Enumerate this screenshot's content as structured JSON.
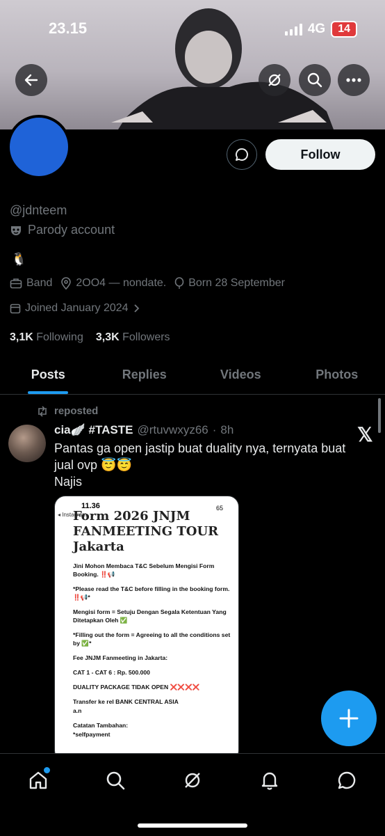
{
  "status_bar": {
    "time": "23.15",
    "network": "4G",
    "battery": "14"
  },
  "profile": {
    "handle": "@jdnteem",
    "parody_label": "Parody account",
    "bio_emoji": "🐧",
    "category": "Band",
    "location": "2OO4 — nondate.",
    "birthday": "Born 28 September",
    "joined": "Joined January 2024",
    "following_count": "3,1K",
    "following_label": "Following",
    "followers_count": "3,3K",
    "followers_label": "Followers",
    "follow_label": "Follow"
  },
  "tabs": [
    "Posts",
    "Replies",
    "Videos",
    "Photos"
  ],
  "post": {
    "reposted_label": "reposted",
    "author_name": "cia🪽 #TASTE",
    "author_handle": "@rtuvwxyz66",
    "time": "8h",
    "text_line1": "Pantas ga open jastip buat duality nya, ternyata buat jual ovp 😇😇",
    "text_line2": "Najis",
    "media": {
      "time": "11.36",
      "app": "◂ Instagram",
      "battery": "65",
      "title": "Form 2026 JNJM FANMEETING TOUR Jakarta",
      "line1": "Jini Mohon Membaca T&C Sebelum Mengisi Form Booking. ‼️📢",
      "line2": "*Please read the T&C before filling in the booking form. ‼️📢*",
      "line3": "Mengisi form = Setuju Dengan Segala Ketentuan Yang Ditetapkan Oleh ✅",
      "line4": "*Filling out the form = Agreeing to all the conditions set by ✅*",
      "line5": "Fee JNJM Fanmeeting in Jakarta:",
      "line6": "CAT 1 - CAT 6 : Rp. 500.000",
      "line7": "DUALITY PACKAGE TIDAK OPEN",
      "line7_marks": "❌❌❌❌",
      "line8": "Transfer ke rel                BANK CENTRAL ASIA",
      "line9": "a.n",
      "line10": "Catatan Tambahan:",
      "line11": "*selfpayment"
    }
  },
  "colors": {
    "accent": "#1d9bf0",
    "avatar": "#1f63d8",
    "background": "#000000"
  }
}
